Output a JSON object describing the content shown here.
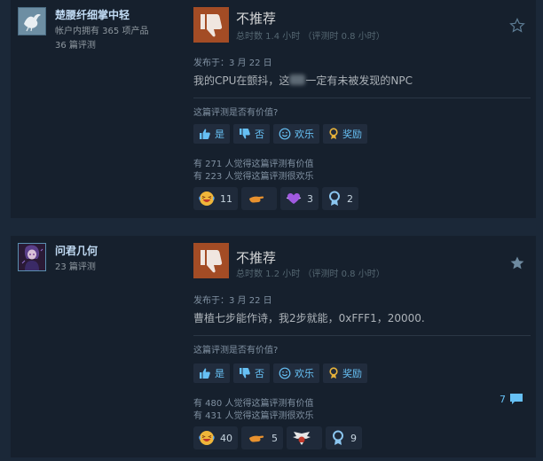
{
  "colors": {
    "background": "#1b2838",
    "card": "#16202d",
    "thumb_box": "#a34c25",
    "link_blue": "#66c0f4",
    "muted_text": "#8091a2"
  },
  "reviews": [
    {
      "author": {
        "name": "楚腰纤细掌中轻",
        "products_owned": "帐户内拥有 365 项产品",
        "review_count": "36 篇评测",
        "avatar_icon": "dove-avatar"
      },
      "verdict": "不推荐",
      "verdict_icon": "thumbs-down-icon",
      "hours": "总时数 1.4 小时 （评测时 0.8 小时）",
      "star_icon": "star-outline-icon",
      "posted": "发布于：3 月 22 日",
      "content_before": "我的CPU在颤抖，这",
      "content_after": "一定有未被发现的NPC",
      "helpful_question": "这篇评测是否有价值?",
      "buttons": {
        "yes": "是",
        "no": "否",
        "funny": "欢乐",
        "award": "奖励"
      },
      "helpful_stat": "有 271 人觉得这篇评测有价值",
      "funny_stat": "有 223 人觉得这篇评测很欢乐",
      "reactions": [
        {
          "icon": "laughing-face-icon",
          "count": "11"
        },
        {
          "icon": "clapping-hand-icon",
          "count": ""
        },
        {
          "icon": "purple-heart-icon",
          "count": "3"
        },
        {
          "icon": "medal-icon",
          "count": "2"
        }
      ]
    },
    {
      "author": {
        "name": "问君几何",
        "review_count": "23 篇评测",
        "avatar_icon": "anime-character-avatar"
      },
      "verdict": "不推荐",
      "verdict_icon": "thumbs-down-icon",
      "hours": "总时数 1.2 小时 （评测时 0.8 小时）",
      "star_icon": "star-filled-icon",
      "posted": "发布于：3 月 22 日",
      "content": "曹植七步能作诗，我2步就能，0xFFF1，20000.",
      "helpful_question": "这篇评测是否有价值?",
      "buttons": {
        "yes": "是",
        "no": "否",
        "funny": "欢乐",
        "award": "奖励"
      },
      "helpful_stat": "有 480 人觉得这篇评测有价值",
      "funny_stat": "有 431 人觉得这篇评测很欢乐",
      "comments_count": "7",
      "reactions": [
        {
          "icon": "laughing-face-icon",
          "count": "40"
        },
        {
          "icon": "clapping-hand-icon",
          "count": "5"
        },
        {
          "icon": "winged-badge-icon",
          "count": ""
        },
        {
          "icon": "medal-icon",
          "count": "9"
        }
      ]
    }
  ]
}
